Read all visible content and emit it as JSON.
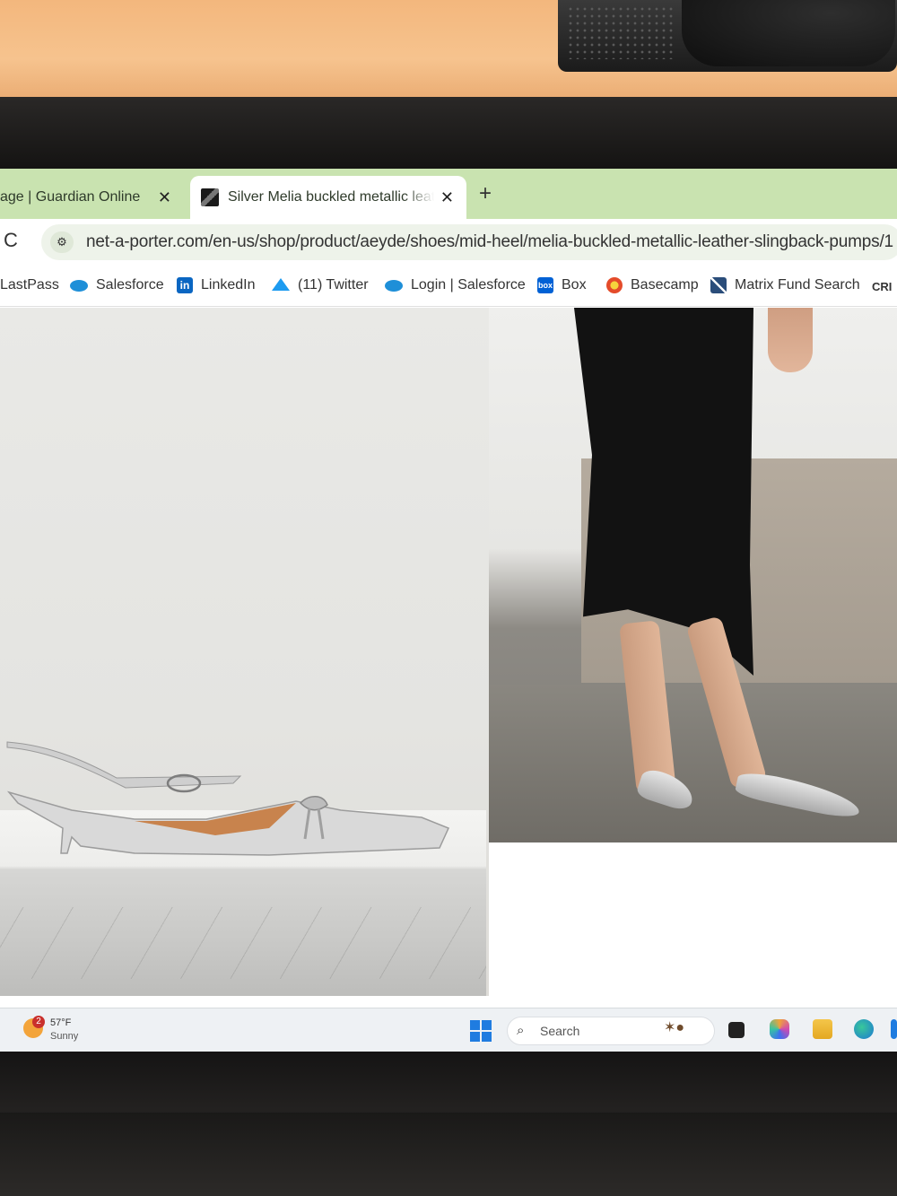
{
  "browser": {
    "tabs": [
      {
        "title": "age | Guardian Online",
        "close": "✕",
        "active": false
      },
      {
        "title": "Silver Melia buckled metallic leather slingback pumps",
        "close": "✕",
        "active": true
      }
    ],
    "new_tab": "+",
    "reload": "C",
    "site_info_icon": "tune-icon",
    "url": "net-a-porter.com/en-us/shop/product/aeyde/shoes/mid-heel/melia-buckled-metallic-leather-slingback-pumps/1"
  },
  "bookmarks": [
    {
      "label": "LastPass",
      "icon": "none"
    },
    {
      "label": "Salesforce",
      "icon": "salesforce-cloud-icon"
    },
    {
      "label": "LinkedIn",
      "icon": "linkedin-icon",
      "glyph": "in"
    },
    {
      "label": "(11) Twitter",
      "icon": "twitter-bird-icon"
    },
    {
      "label": "Login | Salesforce",
      "icon": "salesforce-cloud-icon"
    },
    {
      "label": "Box",
      "icon": "box-icon",
      "glyph": "box"
    },
    {
      "label": "Basecamp",
      "icon": "basecamp-icon"
    },
    {
      "label": "Matrix Fund Search",
      "icon": "matrix-icon"
    },
    {
      "label": "CRI",
      "icon": "none"
    }
  ],
  "product": {
    "images": [
      "product-shot-shoe",
      "model-wearing-shoes"
    ]
  },
  "taskbar": {
    "weather": {
      "badge": "2",
      "temp": "57°F",
      "desc": "Sunny"
    },
    "search_placeholder": "Search",
    "search_glyph": "🔍"
  },
  "colors": {
    "tabstrip": "#c9e3b0",
    "accent_blue": "#1f7ce0"
  }
}
